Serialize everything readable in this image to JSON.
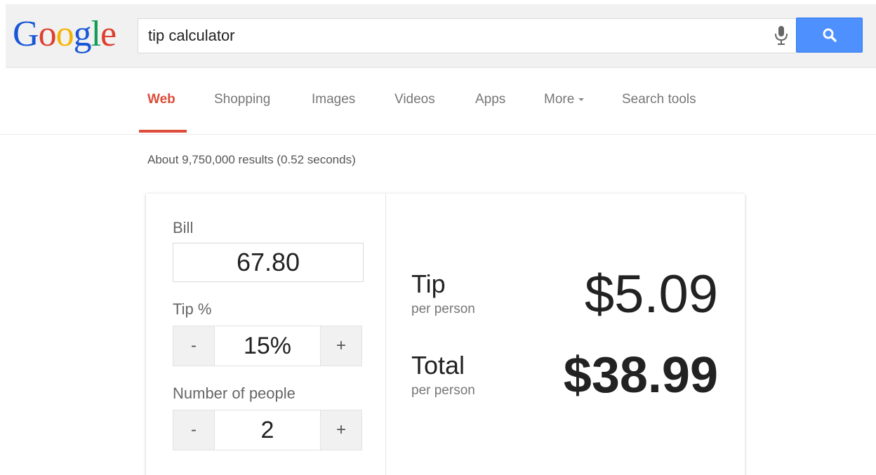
{
  "header": {
    "logo": {
      "letters": [
        "G",
        "o",
        "o",
        "g",
        "l",
        "e"
      ],
      "colors": [
        "#1a57d6",
        "#dd3f2f",
        "#f4b400",
        "#1a57d6",
        "#109d58",
        "#dd3f2f"
      ]
    },
    "search": {
      "query": "tip calculator",
      "mic_icon": "microphone-icon",
      "button_icon": "search-icon",
      "button_color": "#4d90fe"
    }
  },
  "tabs": {
    "items": [
      "Web",
      "Shopping",
      "Images",
      "Videos",
      "Apps",
      "More",
      "Search tools"
    ],
    "active": "Web",
    "active_color": "#dd4b39"
  },
  "result_stats": "About 9,750,000 results (0.52 seconds)",
  "calculator": {
    "bill_label": "Bill",
    "bill_value": "67.80",
    "tip_label": "Tip %",
    "tip_value": "15%",
    "people_label": "Number of people",
    "people_value": "2",
    "minus_label": "-",
    "plus_label": "+",
    "result_tip_label": "Tip",
    "result_tip_sub": "per person",
    "result_tip_value": "$5.09",
    "result_total_label": "Total",
    "result_total_sub": "per person",
    "result_total_value": "$38.99"
  }
}
